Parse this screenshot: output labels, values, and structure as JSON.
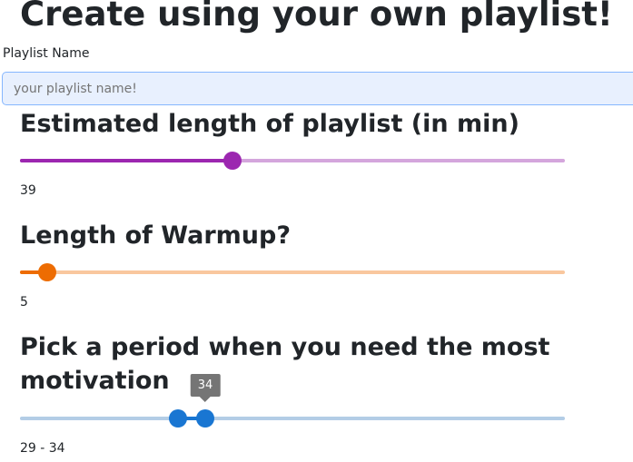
{
  "page": {
    "title": "Create using your own playlist!"
  },
  "playlist_name": {
    "label": "Playlist Name",
    "placeholder": "your playlist name!"
  },
  "length_slider": {
    "heading": "Estimated length of playlist (in min)",
    "min": 0,
    "max": 100,
    "value": 39,
    "value_text": "39",
    "color": "#9c27b0"
  },
  "warmup_slider": {
    "heading": "Length of Warmup?",
    "min": 0,
    "max": 100,
    "value": 5,
    "value_text": "5",
    "color": "#ed6c02"
  },
  "period_slider": {
    "heading": "Pick a period when you need the most motivation",
    "min": 0,
    "max": 100,
    "range": [
      29,
      34
    ],
    "tooltip": "34",
    "value_text": "29 - 34",
    "color": "#1976d2"
  }
}
